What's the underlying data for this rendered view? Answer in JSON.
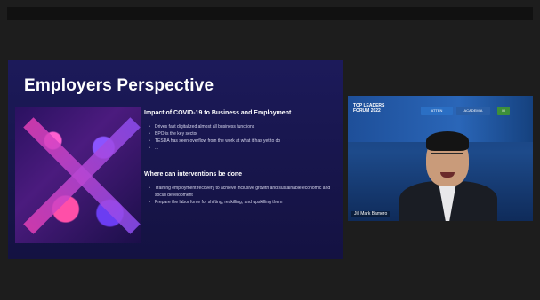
{
  "slide": {
    "title": "Employers Perspective",
    "section1_heading": "Impact of COVID-19 to Business and Employment",
    "section1_bullets": [
      "Drives fast digitalized almost all business functions",
      "BPO is the key sector",
      "TESDA has seen overflow from the work at what it has yet to do",
      "..."
    ],
    "section2_heading": "Where can interventions be done",
    "section2_bullets": [
      "Training employment recovery to achieve inclusive growth and sustainable economic and social development",
      "Prepare the labor force for shifting, reskilling, and upskilling them"
    ]
  },
  "camera": {
    "banner_title": "TOP LEADERS FORUM 2022",
    "logos": [
      "ATTEN",
      "ACADEMIA",
      "M"
    ],
    "name_tag": "Jill Mark Bamero"
  },
  "colors": {
    "slide_bg": "#17154a",
    "accent_pink": "#e23fb6",
    "accent_purple": "#8d4df0",
    "camera_bg": "#1d4a8a"
  }
}
